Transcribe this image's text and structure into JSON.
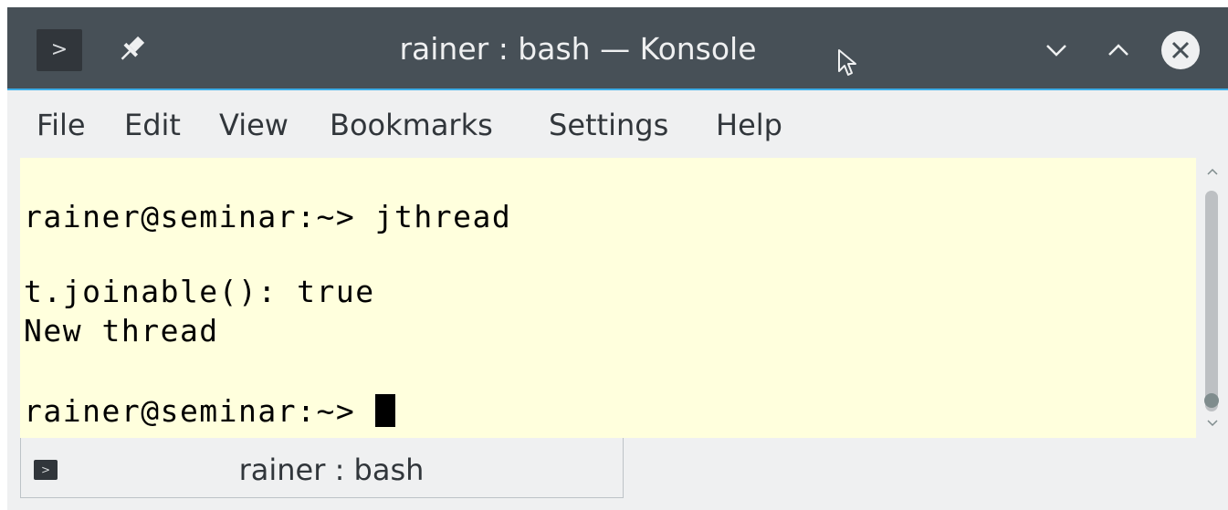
{
  "window": {
    "title": "rainer : bash — Konsole"
  },
  "menu": {
    "items": [
      "File",
      "Edit",
      "View",
      "Bookmarks",
      "Settings",
      "Help"
    ]
  },
  "terminal": {
    "lines": [
      "rainer@seminar:~> jthread",
      "t.joinable(): true",
      "New thread",
      "rainer@seminar:~> "
    ],
    "background": "#ffffdd",
    "foreground": "#000000"
  },
  "tabs": [
    {
      "label": "rainer : bash",
      "icon": "terminal-icon"
    }
  ],
  "icons": {
    "app": "terminal-icon",
    "pin": "pin-icon",
    "minimize": "chevron-down-icon",
    "maximize": "chevron-up-icon",
    "close": "close-icon"
  },
  "colors": {
    "titlebar": "#475057",
    "accent": "#3daee9",
    "chrome": "#eff0f1"
  }
}
